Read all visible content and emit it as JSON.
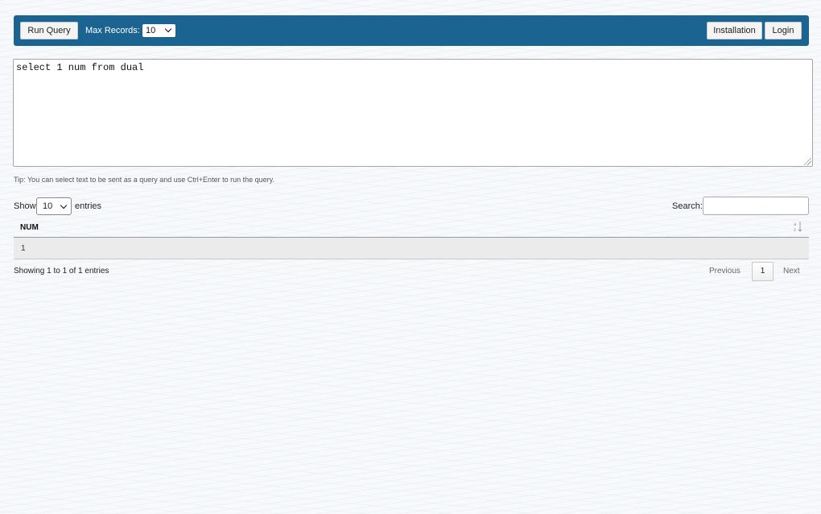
{
  "toolbar": {
    "run_query_label": "Run Query",
    "max_records_label": "Max Records:",
    "max_records_value": "10",
    "installation_label": "Installation",
    "login_label": "Login",
    "bar_color": "#1b6390"
  },
  "editor": {
    "query_text": "select 1 num from dual"
  },
  "tip": "Tip: You can select text to be sent as a query and use Ctrl+Enter to run the query.",
  "table_controls": {
    "show_label": "Show",
    "page_length_value": "10",
    "entries_label": "entries",
    "search_label": "Search:",
    "search_value": ""
  },
  "table": {
    "columns": [
      "NUM"
    ],
    "rows": [
      [
        "1"
      ]
    ],
    "sort_icon": "sort-alpha-icon"
  },
  "footer": {
    "info": "Showing 1 to 1 of 1 entries",
    "previous_label": "Previous",
    "current_page": "1",
    "next_label": "Next"
  }
}
